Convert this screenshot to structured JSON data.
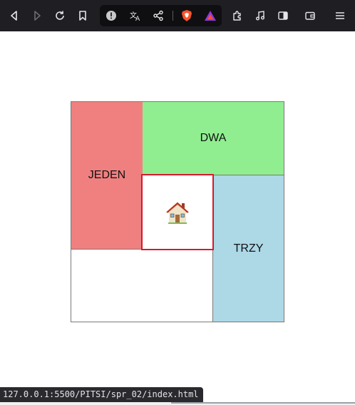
{
  "browser": {
    "toolbar_icons": [
      "back-icon",
      "forward-icon",
      "reload-icon",
      "bookmark-icon",
      "site-info-icon",
      "translate-icon",
      "share-icon",
      "brave-shield-icon",
      "rewards-icon",
      "extensions-icon",
      "media-icon",
      "sidebar-icon",
      "wallet-icon",
      "menu-icon"
    ],
    "status_url": "127.0.0.1:5500/PITSI/spr_02/index.html"
  },
  "page": {
    "cells": {
      "jeden": "JEDEN",
      "dwa": "DWA",
      "trzy": "TRZY",
      "home_emoji": "house-icon"
    },
    "colors": {
      "jeden": "#f08080",
      "dwa": "#90ee90",
      "trzy": "#add8e6",
      "home_border": "#d6192f"
    }
  }
}
